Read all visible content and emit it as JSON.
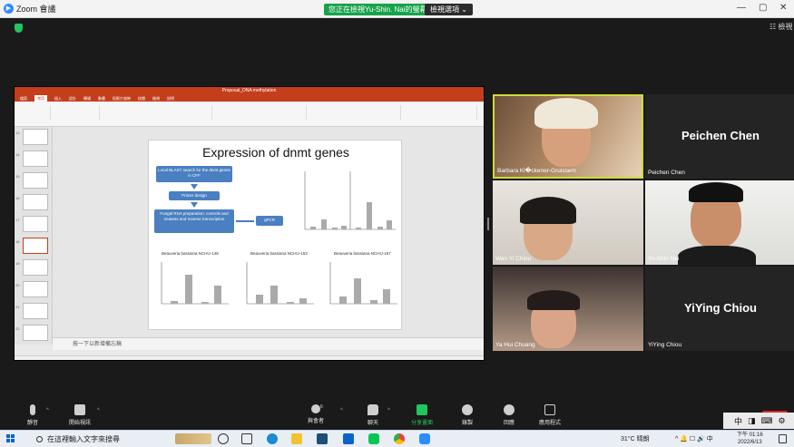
{
  "window": {
    "title": "Zoom 會議",
    "share_banner": "您正在檢視Yu-Shin. Nai的螢幕",
    "view_options": "檢視選項 ⌄",
    "view_button": "檢視"
  },
  "ppt": {
    "file_title": "Proposal_DNA methylation",
    "tabs": [
      "檔案",
      "常用",
      "插入",
      "設計",
      "轉場",
      "動畫",
      "投影片放映",
      "校閱",
      "檢視",
      "說明"
    ],
    "slide_title": "Expression of dnmt genes",
    "flow": {
      "blast": "Local BLAST search for the dnmt genes in CFF",
      "primer": "Primer design",
      "rna": "Fungal RNA preparation: controls and mutants and reverse transcription",
      "qpcr": "qPCR"
    },
    "chart_titles": [
      "Beauveria bassiana NCHU-148",
      "Beauveria bassiana NCHU-153",
      "Beauveria bassiana NCHU-157"
    ],
    "notes_text": "按一下以新增備忘稿",
    "thumb_numbers": [
      "13",
      "14",
      "15",
      "16",
      "17",
      "18",
      "19",
      "20",
      "21",
      "22"
    ]
  },
  "participants": [
    {
      "name": "Barbara Klöckener-Gruissem",
      "label": "Barbara Kl�ckener-Gruissem",
      "video": true,
      "active": true
    },
    {
      "name": "Peichen Chen",
      "label": "Peichen Chen",
      "video": false
    },
    {
      "name": "Wan Yi Chiou",
      "label": "Wan Yi Chiou",
      "video": true
    },
    {
      "name": "Yu-Shin Nai",
      "label": "Yu-Shin Nai",
      "video": true
    },
    {
      "name": "Ya Hui Chuang",
      "label": "Ya Hui Chuang",
      "video": true
    },
    {
      "name": "YiYing Chiou",
      "label": "YiYing Chiou",
      "video": false
    }
  ],
  "toolbar": {
    "mute": "靜音",
    "video": "開始視訊",
    "participants": "與會者",
    "participants_count": "6",
    "chat": "聊天",
    "share": "分享畫面",
    "record": "錄製",
    "reactions": "回應",
    "apps": "應用程式"
  },
  "ime": {
    "chars": [
      "中",
      "◨",
      "⌨",
      "⚙"
    ]
  },
  "taskbar": {
    "search_placeholder": "在這裡輸入文字來搜尋",
    "weather": "31°C 晴朗",
    "tray_icons": "^ 🔔 ☐ 🔊 中",
    "time": "下午 01:16",
    "date": "2022/6/13"
  },
  "colors": {
    "ppt_red": "#c43e1c",
    "zoom_green": "#16a34a",
    "active_speaker": "#cddc39",
    "flow_blue": "#4a7fc1"
  }
}
